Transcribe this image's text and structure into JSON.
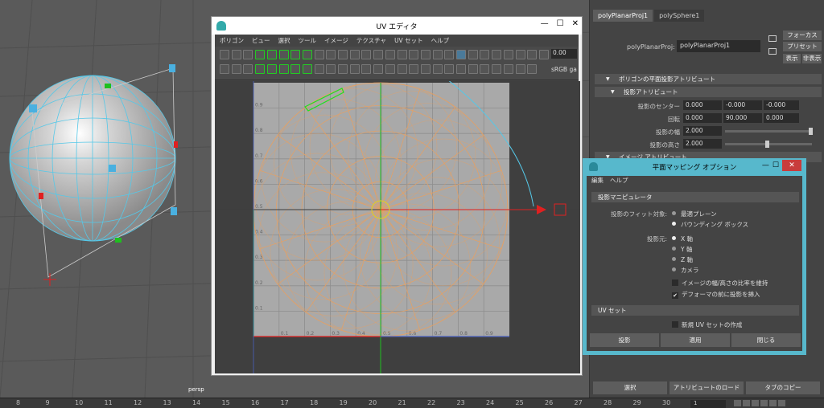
{
  "viewport": {
    "camera_label": "persp"
  },
  "timeline": {
    "ticks": [
      "8",
      "9",
      "10",
      "11",
      "12",
      "13",
      "14",
      "15",
      "16",
      "17",
      "18",
      "19",
      "20",
      "21",
      "22",
      "23",
      "24",
      "25",
      "26",
      "27",
      "28",
      "29",
      "30"
    ],
    "current_frame": "1"
  },
  "uv_editor": {
    "title": "UV エディタ",
    "menu": [
      "ポリゴン",
      "ビュー",
      "選択",
      "ツール",
      "イメージ",
      "テクスチャ",
      "UV セット",
      "ヘルプ"
    ],
    "value_field": "0.00",
    "color_space": "sRGB ga",
    "grid_labels_y": [
      "0.9",
      "0.8",
      "0.7",
      "0.6",
      "0.5",
      "0.4",
      "0.3",
      "0.2",
      "0.1"
    ],
    "grid_labels_x": [
      "0.1",
      "0.2",
      "0.3",
      "0.4",
      "0.5",
      "0.6",
      "0.7",
      "0.8",
      "0.9"
    ]
  },
  "attribute_editor": {
    "tabs": [
      "polyPlanarProj1",
      "polySphere1"
    ],
    "node_label": "polyPlanarProj:",
    "node_name": "polyPlanarProj1",
    "buttons": {
      "focus": "フォーカス",
      "preset": "プリセット",
      "show": "表示",
      "hide": "非表示"
    },
    "section_main": "ポリゴンの平面投影アトリビュート",
    "section_projection": "投影アトリビュート",
    "center_label": "投影のセンター",
    "center": [
      "0.000",
      "-0.000",
      "-0.000"
    ],
    "rotate_label": "回転",
    "rotate": [
      "0.000",
      "90.000",
      "0.000"
    ],
    "width_label": "投影の幅",
    "width": "2.000",
    "height_label": "投影の高さ",
    "height": "2.000",
    "section_image": "イメージ アトリビュート",
    "bottom": {
      "select": "選択",
      "load": "アトリビュートのロード",
      "copy_tab": "タブのコピー"
    }
  },
  "dialog": {
    "title": "平面マッピング オプション",
    "menu": [
      "編集",
      "ヘルプ"
    ],
    "section_manip": "投影マニピュレータ",
    "fit_label": "投影のフィット対象:",
    "fit_options": [
      "最適プレーン",
      "バウンディング ボックス"
    ],
    "source_label": "投影元:",
    "source_options": [
      "X 軸",
      "Y 軸",
      "Z 軸",
      "カメラ"
    ],
    "keep_ratio": "イメージの幅/高さの比率を維持",
    "insert_before": "デフォーマの前に投影を挿入",
    "section_uvset": "UV セット",
    "new_uvset": "新規 UV セットの作成",
    "btn_project": "投影",
    "btn_apply": "適用",
    "btn_close": "閉じる"
  }
}
